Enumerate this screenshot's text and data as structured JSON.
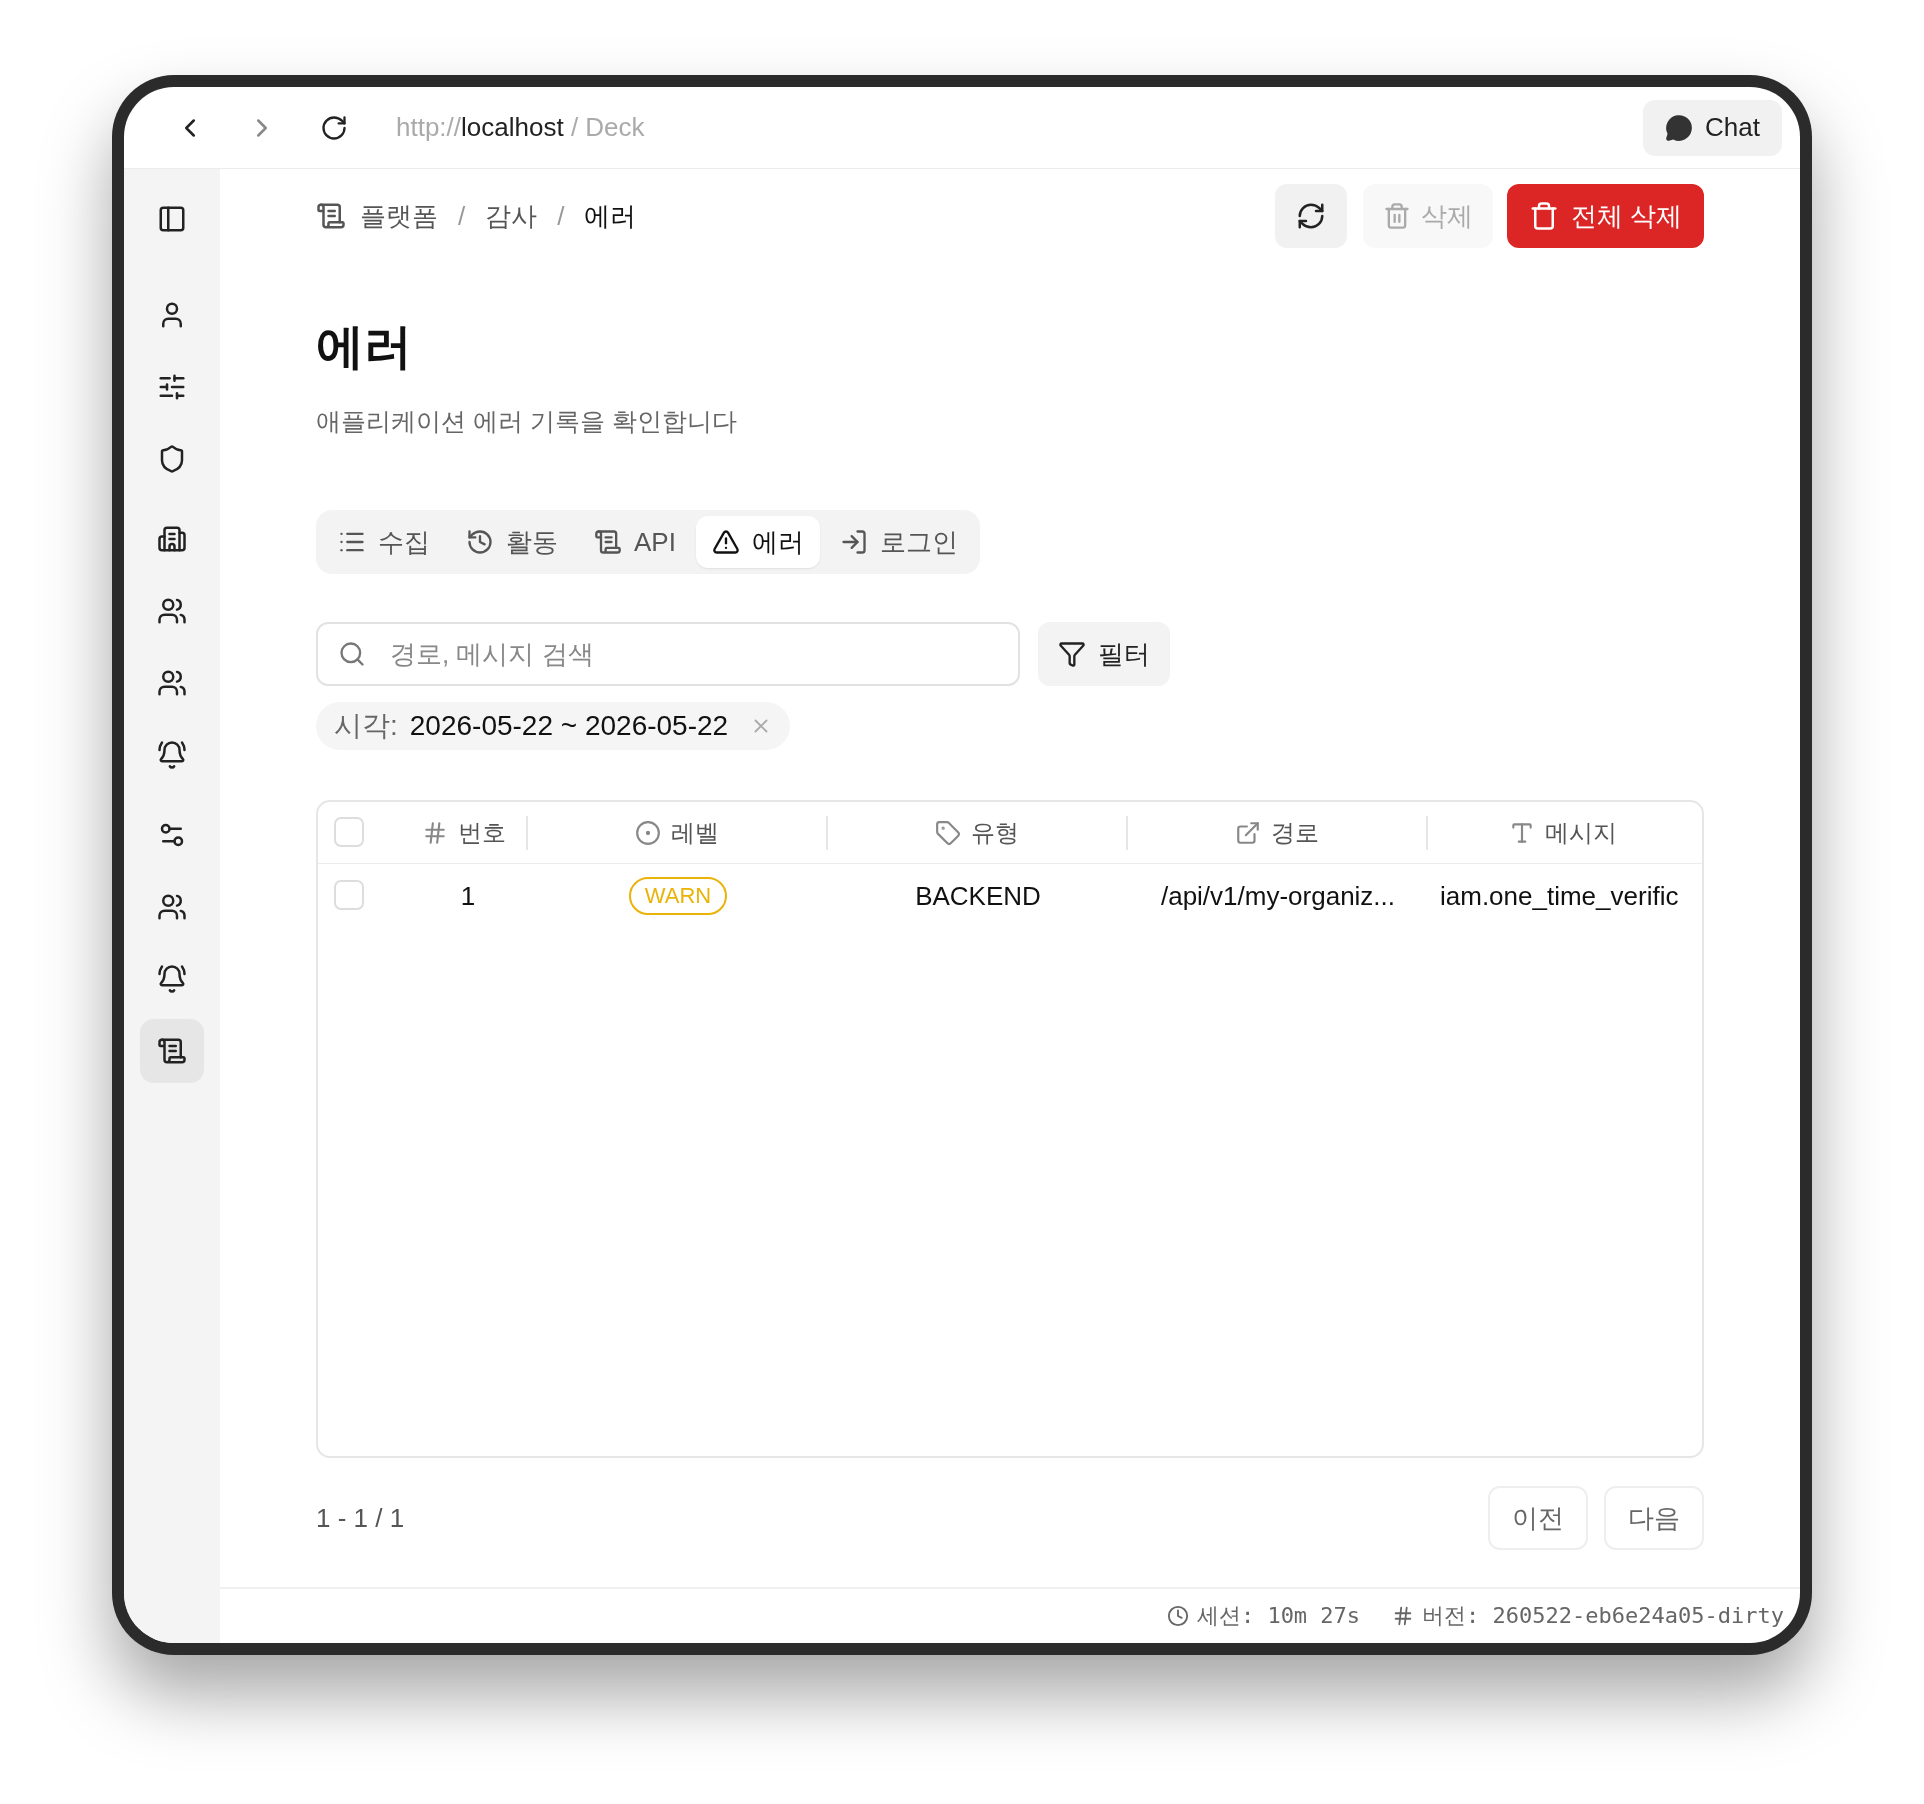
{
  "browser": {
    "url_scheme": "http://",
    "url_host": "localhost",
    "url_path": " / Deck",
    "chat_button": "Chat"
  },
  "sidebar": {
    "items": [
      {
        "selected": false
      },
      {
        "selected": false
      },
      {
        "selected": false
      },
      {
        "selected": false
      },
      {
        "selected": false
      },
      {
        "selected": false
      },
      {
        "selected": false
      },
      {
        "selected": false
      },
      {
        "selected": false
      },
      {
        "selected": false
      },
      {
        "selected": true
      }
    ]
  },
  "breadcrumb": [
    {
      "kind": "link",
      "label": "플랫폼"
    },
    {
      "kind": "separator",
      "label": "/"
    },
    {
      "kind": "link",
      "label": "감사"
    },
    {
      "kind": "separator",
      "label": "/"
    },
    {
      "kind": "current",
      "label": "에러"
    }
  ],
  "actions": {
    "delete": {
      "label": "삭제",
      "disabled": true
    },
    "delete_all": {
      "label": "전체 삭제"
    }
  },
  "title": "에러",
  "subtitle": "애플리케이션 에러 기록을 확인합니다",
  "tabs": [
    {
      "label": "수집",
      "selected": false
    },
    {
      "label": "활동",
      "selected": false
    },
    {
      "label": "API",
      "selected": false
    },
    {
      "label": "에러",
      "selected": true
    },
    {
      "label": "로그인",
      "selected": false
    }
  ],
  "search": {
    "placeholder": "경로, 메시지 검색"
  },
  "filter_button": "필터",
  "filter_chips": [
    {
      "label": "시각:",
      "value": "2026-05-22 ~ 2026-05-22"
    }
  ],
  "table": {
    "select_all_checked": false,
    "columns": [
      "번호",
      "레벨",
      "유형",
      "경로",
      "메시지"
    ],
    "rows": [
      {
        "checked": false,
        "number": "1",
        "level": "WARN",
        "color": "#eab308",
        "type": "BACKEND",
        "path": "/api/v1/my-organiz...",
        "message": "iam.one_time_verific"
      }
    ]
  },
  "pagination": {
    "range": "1 - 1 / 1",
    "prev": "이전",
    "next": "다음"
  },
  "status_bar": {
    "session": "세션: 10m 27s",
    "version": "버전: 260522-eb6e24a05-dirty"
  }
}
